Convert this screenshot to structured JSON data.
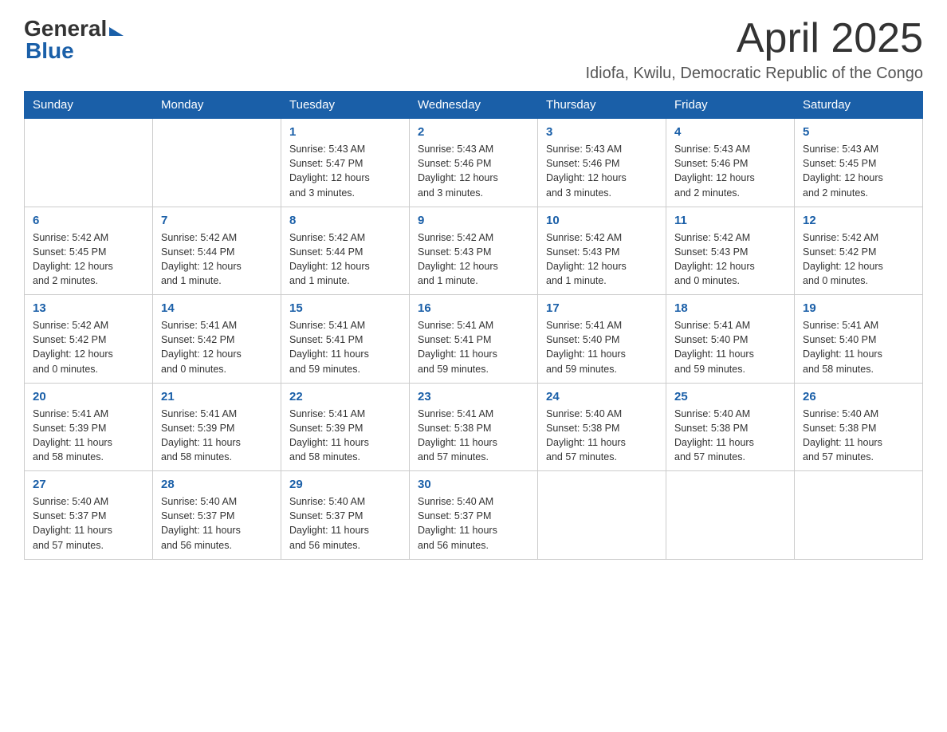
{
  "header": {
    "logo_general": "General",
    "logo_blue": "Blue",
    "month_title": "April 2025",
    "location": "Idiofa, Kwilu, Democratic Republic of the Congo"
  },
  "weekdays": [
    "Sunday",
    "Monday",
    "Tuesday",
    "Wednesday",
    "Thursday",
    "Friday",
    "Saturday"
  ],
  "weeks": [
    [
      {
        "day": "",
        "info": ""
      },
      {
        "day": "",
        "info": ""
      },
      {
        "day": "1",
        "info": "Sunrise: 5:43 AM\nSunset: 5:47 PM\nDaylight: 12 hours\nand 3 minutes."
      },
      {
        "day": "2",
        "info": "Sunrise: 5:43 AM\nSunset: 5:46 PM\nDaylight: 12 hours\nand 3 minutes."
      },
      {
        "day": "3",
        "info": "Sunrise: 5:43 AM\nSunset: 5:46 PM\nDaylight: 12 hours\nand 3 minutes."
      },
      {
        "day": "4",
        "info": "Sunrise: 5:43 AM\nSunset: 5:46 PM\nDaylight: 12 hours\nand 2 minutes."
      },
      {
        "day": "5",
        "info": "Sunrise: 5:43 AM\nSunset: 5:45 PM\nDaylight: 12 hours\nand 2 minutes."
      }
    ],
    [
      {
        "day": "6",
        "info": "Sunrise: 5:42 AM\nSunset: 5:45 PM\nDaylight: 12 hours\nand 2 minutes."
      },
      {
        "day": "7",
        "info": "Sunrise: 5:42 AM\nSunset: 5:44 PM\nDaylight: 12 hours\nand 1 minute."
      },
      {
        "day": "8",
        "info": "Sunrise: 5:42 AM\nSunset: 5:44 PM\nDaylight: 12 hours\nand 1 minute."
      },
      {
        "day": "9",
        "info": "Sunrise: 5:42 AM\nSunset: 5:43 PM\nDaylight: 12 hours\nand 1 minute."
      },
      {
        "day": "10",
        "info": "Sunrise: 5:42 AM\nSunset: 5:43 PM\nDaylight: 12 hours\nand 1 minute."
      },
      {
        "day": "11",
        "info": "Sunrise: 5:42 AM\nSunset: 5:43 PM\nDaylight: 12 hours\nand 0 minutes."
      },
      {
        "day": "12",
        "info": "Sunrise: 5:42 AM\nSunset: 5:42 PM\nDaylight: 12 hours\nand 0 minutes."
      }
    ],
    [
      {
        "day": "13",
        "info": "Sunrise: 5:42 AM\nSunset: 5:42 PM\nDaylight: 12 hours\nand 0 minutes."
      },
      {
        "day": "14",
        "info": "Sunrise: 5:41 AM\nSunset: 5:42 PM\nDaylight: 12 hours\nand 0 minutes."
      },
      {
        "day": "15",
        "info": "Sunrise: 5:41 AM\nSunset: 5:41 PM\nDaylight: 11 hours\nand 59 minutes."
      },
      {
        "day": "16",
        "info": "Sunrise: 5:41 AM\nSunset: 5:41 PM\nDaylight: 11 hours\nand 59 minutes."
      },
      {
        "day": "17",
        "info": "Sunrise: 5:41 AM\nSunset: 5:40 PM\nDaylight: 11 hours\nand 59 minutes."
      },
      {
        "day": "18",
        "info": "Sunrise: 5:41 AM\nSunset: 5:40 PM\nDaylight: 11 hours\nand 59 minutes."
      },
      {
        "day": "19",
        "info": "Sunrise: 5:41 AM\nSunset: 5:40 PM\nDaylight: 11 hours\nand 58 minutes."
      }
    ],
    [
      {
        "day": "20",
        "info": "Sunrise: 5:41 AM\nSunset: 5:39 PM\nDaylight: 11 hours\nand 58 minutes."
      },
      {
        "day": "21",
        "info": "Sunrise: 5:41 AM\nSunset: 5:39 PM\nDaylight: 11 hours\nand 58 minutes."
      },
      {
        "day": "22",
        "info": "Sunrise: 5:41 AM\nSunset: 5:39 PM\nDaylight: 11 hours\nand 58 minutes."
      },
      {
        "day": "23",
        "info": "Sunrise: 5:41 AM\nSunset: 5:38 PM\nDaylight: 11 hours\nand 57 minutes."
      },
      {
        "day": "24",
        "info": "Sunrise: 5:40 AM\nSunset: 5:38 PM\nDaylight: 11 hours\nand 57 minutes."
      },
      {
        "day": "25",
        "info": "Sunrise: 5:40 AM\nSunset: 5:38 PM\nDaylight: 11 hours\nand 57 minutes."
      },
      {
        "day": "26",
        "info": "Sunrise: 5:40 AM\nSunset: 5:38 PM\nDaylight: 11 hours\nand 57 minutes."
      }
    ],
    [
      {
        "day": "27",
        "info": "Sunrise: 5:40 AM\nSunset: 5:37 PM\nDaylight: 11 hours\nand 57 minutes."
      },
      {
        "day": "28",
        "info": "Sunrise: 5:40 AM\nSunset: 5:37 PM\nDaylight: 11 hours\nand 56 minutes."
      },
      {
        "day": "29",
        "info": "Sunrise: 5:40 AM\nSunset: 5:37 PM\nDaylight: 11 hours\nand 56 minutes."
      },
      {
        "day": "30",
        "info": "Sunrise: 5:40 AM\nSunset: 5:37 PM\nDaylight: 11 hours\nand 56 minutes."
      },
      {
        "day": "",
        "info": ""
      },
      {
        "day": "",
        "info": ""
      },
      {
        "day": "",
        "info": ""
      }
    ]
  ]
}
